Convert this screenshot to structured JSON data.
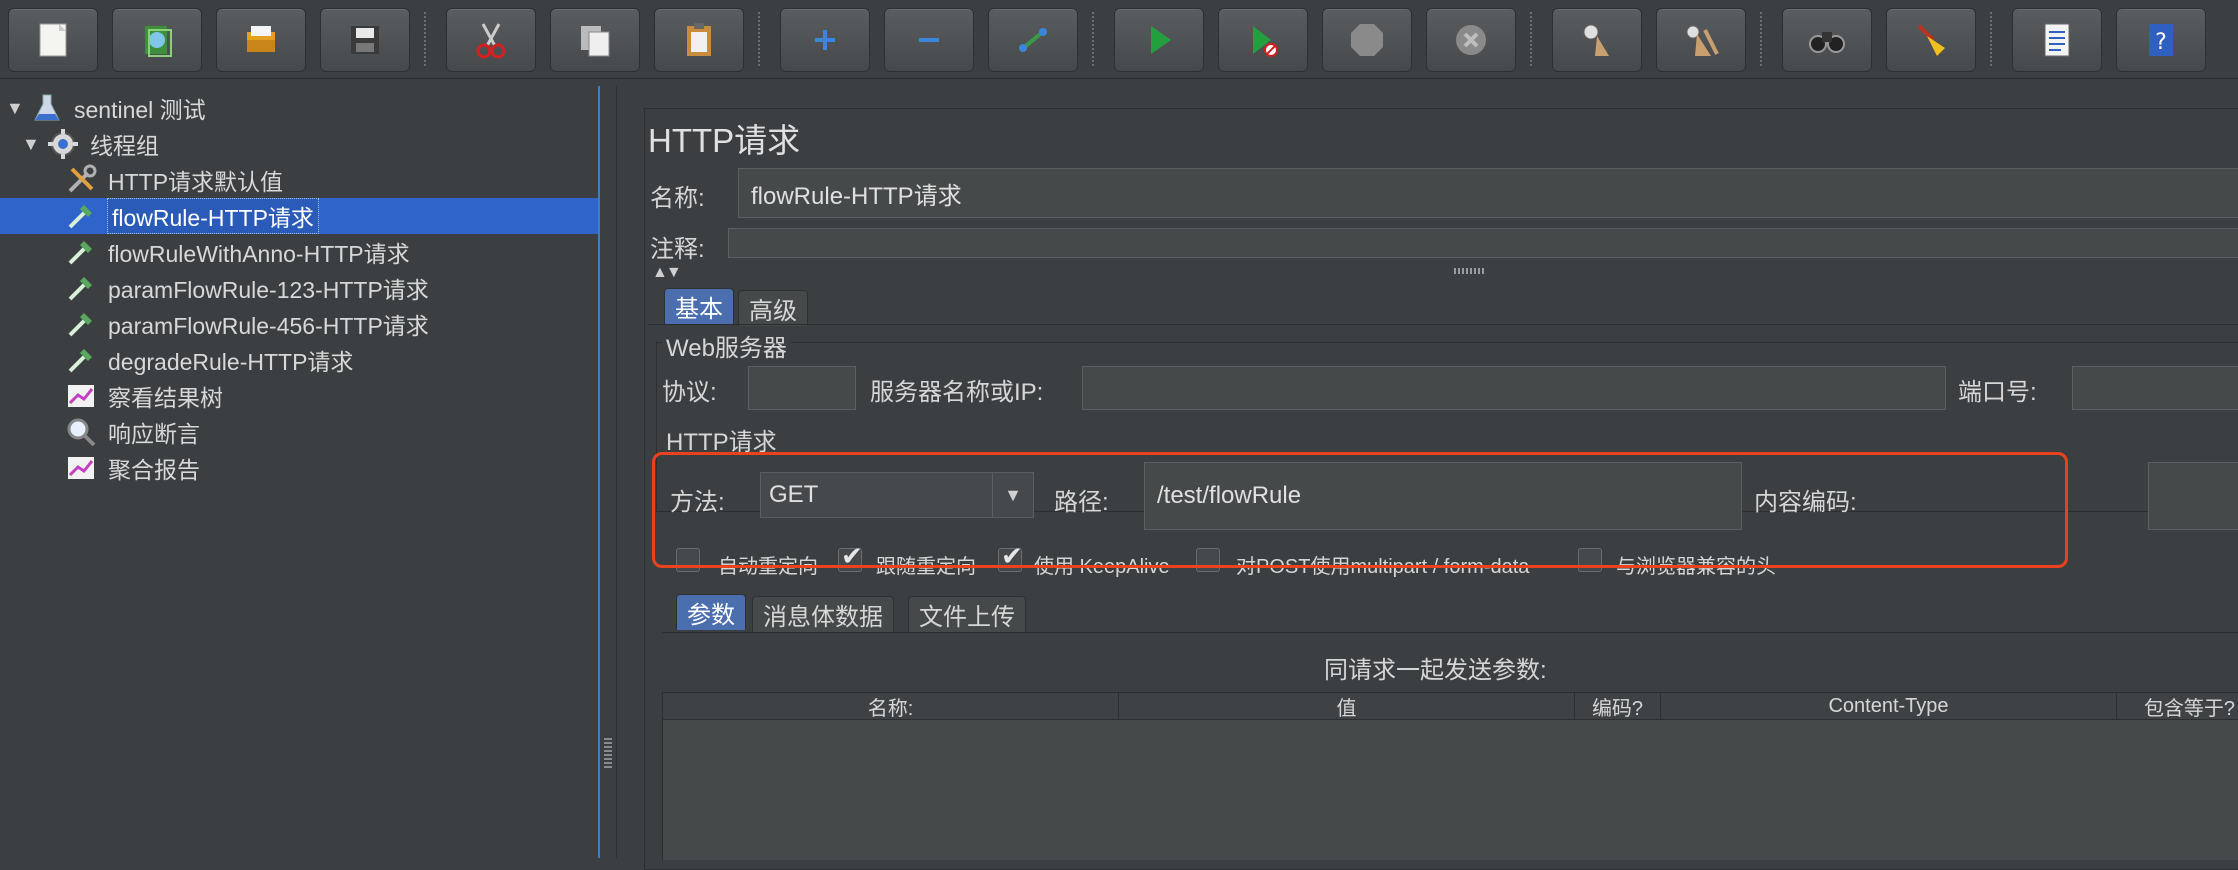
{
  "toolbar": {
    "buttons": [
      {
        "name": "new-icon",
        "color": "#f2f2ee"
      },
      {
        "name": "templates-icon",
        "color": "#4fa03f"
      },
      {
        "name": "open-icon",
        "color": "#e0a020"
      },
      {
        "name": "save-icon",
        "color": "#505050"
      },
      {
        "name": "cut-icon",
        "color": "#d02020"
      },
      {
        "name": "copy-icon",
        "color": "#e8e8e8"
      },
      {
        "name": "paste-icon",
        "color": "#c89040"
      },
      {
        "name": "expand-icon",
        "color": "#2f7fd0"
      },
      {
        "name": "collapse-icon",
        "color": "#2f7fd0"
      },
      {
        "name": "toggle-icon",
        "color": "#3a9a4a"
      },
      {
        "name": "start-icon",
        "color": "#22a040"
      },
      {
        "name": "start-no-pause-icon",
        "color": "#22a040"
      },
      {
        "name": "stop-icon",
        "color": "#8a8a8a"
      },
      {
        "name": "shutdown-icon",
        "color": "#8a8a8a"
      },
      {
        "name": "clear-icon",
        "color": "#c0a070"
      },
      {
        "name": "clear-all-icon",
        "color": "#c0a070"
      },
      {
        "name": "search-icon",
        "color": "#222222"
      },
      {
        "name": "reset-search-icon",
        "color": "#f0c020"
      },
      {
        "name": "function-helper-icon",
        "color": "#f0f0f0"
      },
      {
        "name": "help-icon",
        "color": "#2f5fc0"
      }
    ]
  },
  "tree": {
    "items": [
      {
        "label": "sentinel 测试",
        "icon": "flask-icon",
        "level": 0,
        "expanded": "▼"
      },
      {
        "label": "线程组",
        "icon": "gear-icon",
        "level": 1,
        "expanded": "▼"
      },
      {
        "label": "HTTP请求默认值",
        "icon": "wrench-icon",
        "level": 2
      },
      {
        "label": "flowRule-HTTP请求",
        "icon": "pipette-icon",
        "level": 2,
        "selected": true
      },
      {
        "label": "flowRuleWithAnno-HTTP请求",
        "icon": "pipette-icon",
        "level": 2
      },
      {
        "label": "paramFlowRule-123-HTTP请求",
        "icon": "pipette-icon",
        "level": 2
      },
      {
        "label": "paramFlowRule-456-HTTP请求",
        "icon": "pipette-icon",
        "level": 2
      },
      {
        "label": "degradeRule-HTTP请求",
        "icon": "pipette-icon",
        "level": 2
      },
      {
        "label": "察看结果树",
        "icon": "chart-icon",
        "level": 2
      },
      {
        "label": "响应断言",
        "icon": "magnifier-icon",
        "level": 2
      },
      {
        "label": "聚合报告",
        "icon": "chart-icon",
        "level": 2
      }
    ]
  },
  "panel": {
    "title": "HTTP请求",
    "name_label": "名称:",
    "name_value": "flowRule-HTTP请求",
    "comment_label": "注释:",
    "comment_value": "",
    "tabs": [
      "基本",
      "高级"
    ],
    "web_server": {
      "title": "Web服务器",
      "protocol_label": "协议:",
      "protocol_value": "",
      "server_label": "服务器名称或IP:",
      "server_value": "",
      "port_label": "端口号:",
      "port_value": ""
    },
    "http_request": {
      "title": "HTTP请求",
      "method_label": "方法:",
      "method_value": "GET",
      "path_label": "路径:",
      "path_value": "/test/flowRule",
      "encoding_label": "内容编码:",
      "encoding_value": "",
      "checkboxes": [
        {
          "label": "自动重定向",
          "checked": false
        },
        {
          "label": "跟随重定向",
          "checked": true
        },
        {
          "label": "使用 KeepAlive",
          "checked": true
        },
        {
          "label": "对POST使用multipart / form-data",
          "checked": false
        },
        {
          "label": "与浏览器兼容的头",
          "checked": false
        }
      ]
    },
    "sub_tabs": [
      "参数",
      "消息体数据",
      "文件上传"
    ],
    "params": {
      "caption": "同请求一起发送参数:",
      "columns": [
        "名称:",
        "值",
        "编码?",
        "Content-Type",
        "包含等于?"
      ]
    }
  },
  "colors": {
    "background": "#3c3f41",
    "selection": "#2f65ca",
    "active_tab": "#4b6eaf",
    "highlight": "#e8431d"
  }
}
